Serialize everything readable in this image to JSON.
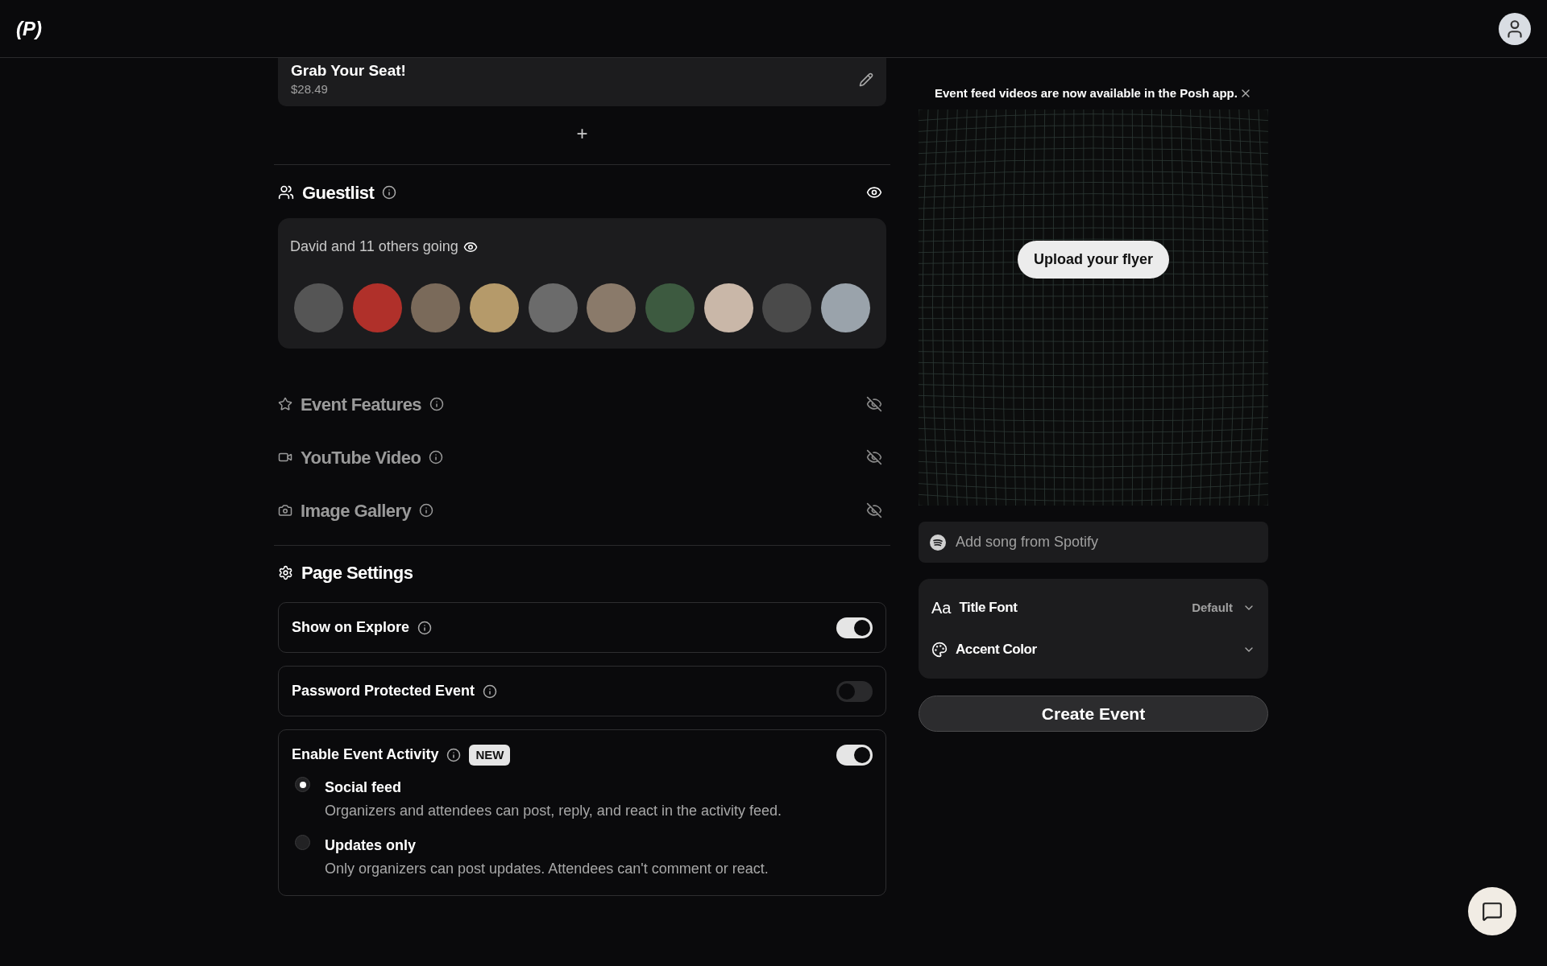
{
  "header": {
    "logo": "(P)"
  },
  "ticket": {
    "name": "Grab Your Seat!",
    "price": "$28.49",
    "add_label": "+"
  },
  "guestlist": {
    "title": "Guestlist",
    "visible": true,
    "summary": "David and 11 others going"
  },
  "sections": [
    {
      "kind": "star",
      "title": "Event Features",
      "visible": false
    },
    {
      "kind": "video",
      "title": "YouTube Video",
      "visible": false
    },
    {
      "kind": "camera",
      "title": "Image Gallery",
      "visible": false
    }
  ],
  "page_settings": {
    "title": "Page Settings",
    "toggles": [
      {
        "label": "Show on Explore",
        "on": true
      },
      {
        "label": "Password Protected Event",
        "on": false
      },
      {
        "label": "Enable Event Activity",
        "badge": "NEW",
        "on": true,
        "options": [
          {
            "label": "Social feed",
            "description": "Organizers and attendees can post, reply, and react in the activity feed.",
            "selected": true
          },
          {
            "label": "Updates only",
            "description": "Only organizers can post updates. Attendees can't comment or react.",
            "selected": false
          }
        ]
      }
    ]
  },
  "notice": {
    "text": "Event feed videos are now available in the Posh app."
  },
  "flyer": {
    "button": "Upload your flyer"
  },
  "spotify": {
    "placeholder": "Add song from Spotify"
  },
  "style_options": [
    {
      "kind": "font",
      "icon_text": "Aa",
      "label": "Title Font",
      "value": "Default"
    },
    {
      "kind": "color",
      "label": "Accent Color"
    }
  ],
  "create_button": "Create Event"
}
